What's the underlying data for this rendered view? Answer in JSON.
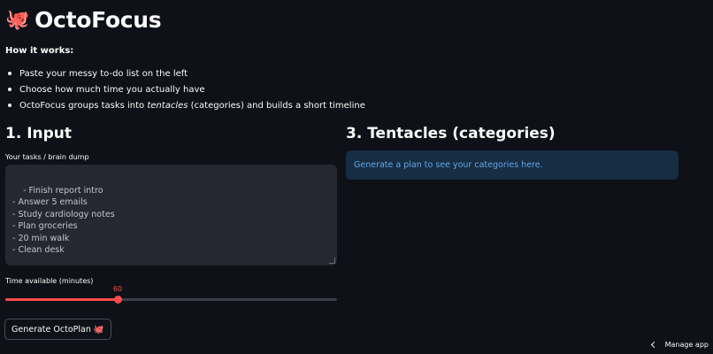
{
  "header": {
    "emoji": "🐙",
    "title": "OctoFocus"
  },
  "intro": {
    "heading": "How it works:",
    "bullets": [
      {
        "text": "Paste your messy to-do list on the left"
      },
      {
        "text": "Choose how much time you actually have"
      },
      {
        "pre": "OctoFocus groups tasks into ",
        "em": "tentacles",
        "post": " (categories) and builds a short timeline"
      }
    ]
  },
  "input_section": {
    "heading": "1. Input",
    "tasks_label": "Your tasks / brain dump",
    "tasks_value": "- Finish report intro\n- Answer 5 emails\n- Study cardiology notes\n- Plan groceries\n- 20 min walk\n- Clean desk",
    "time_label": "Time available (minutes)",
    "time_value": 60,
    "time_fraction": 0.338,
    "generate_label": "Generate OctoPlan",
    "generate_emoji": "🐙"
  },
  "tentacles_section": {
    "heading": "3. Tentacles (categories)",
    "info_text": "Generate a plan to see your categories here."
  },
  "footer": {
    "manage_label": "Manage app"
  },
  "colors": {
    "background": "#0e1117",
    "accent": "#ff4b4b",
    "info_bg": "#172d43",
    "info_text": "#5fa8e8"
  }
}
